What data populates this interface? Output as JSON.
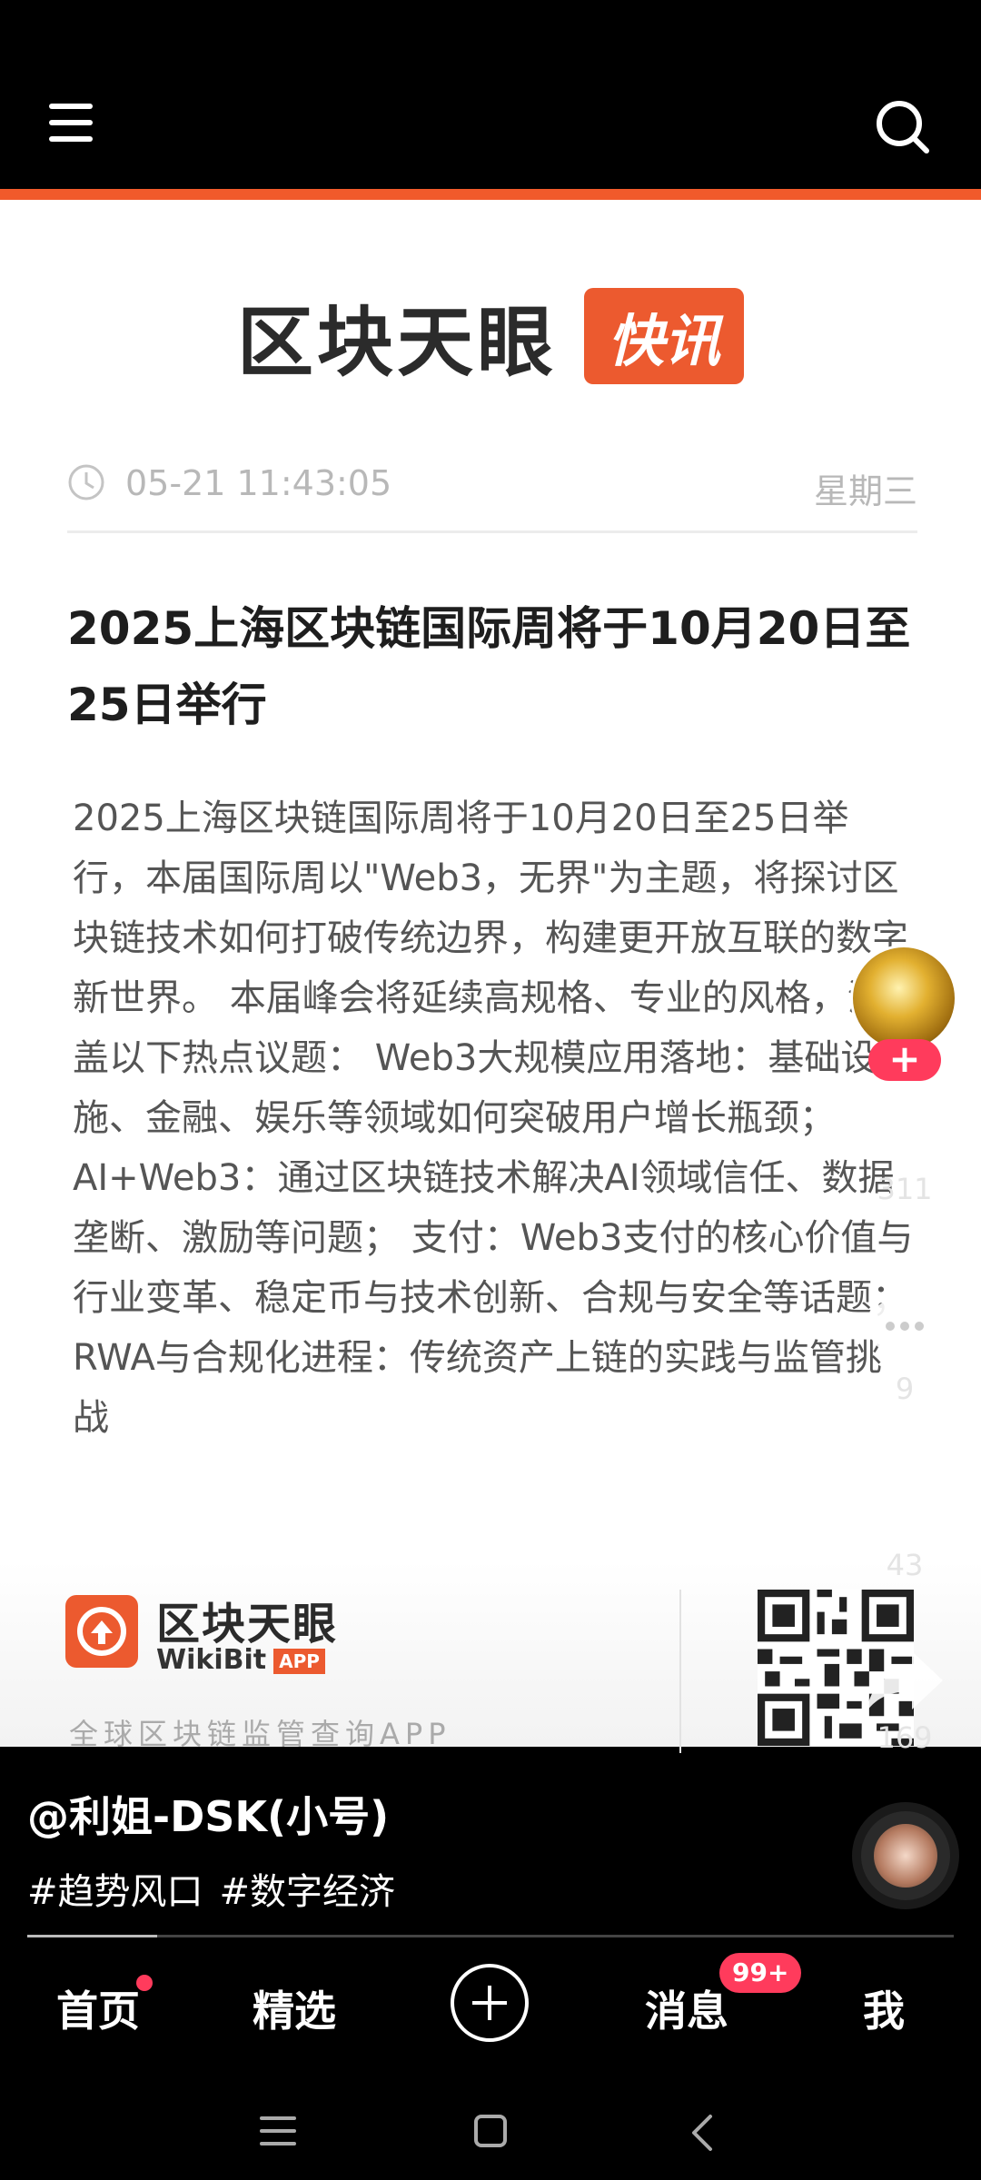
{
  "header": {
    "menu_icon": "menu-icon",
    "search_icon": "search-icon"
  },
  "card": {
    "brand_name": "区块天眼",
    "brand_badge": "快讯",
    "time": "05-21 11:43:05",
    "weekday": "星期三",
    "title": "2025上海区块链国际周将于10月20日至25日举行",
    "body": "2025上海区块链国际周将于10月20日至25日举行，本届国际周以\"Web3，无界\"为主题，将探讨区块链技术如何打破传统边界，构建更开放互联的数字新世界。 本届峰会将延续高规格、专业的风格，涵盖以下热点议题： Web3大规模应用落地：基础设施、金融、娱乐等领域如何突破用户增长瓶颈； AI+Web3：通过区块链技术解决AI领域信任、数据垄断、激励等问题； 支付：Web3支付的核心价值与行业变革、稳定币与技术创新、合规与安全等话题； RWA与合规化进程：传统资产上链的实践与监管挑战",
    "footer_brand": "区块天眼",
    "footer_sub": "WikiBit",
    "footer_app": "APP",
    "footer_slogan": "全球区块链监管查询APP"
  },
  "rail": {
    "follow": "+",
    "likes": "311",
    "comments": "9",
    "favorites": "43",
    "shares": "169"
  },
  "post": {
    "author": "@利姐-DSK(小号)",
    "tags": [
      "#趋势风口",
      "#数字经济"
    ],
    "progress": 0.14
  },
  "nav": {
    "home": "首页",
    "featured": "精选",
    "messages": "消息",
    "messages_badge": "99+",
    "me": "我"
  },
  "colors": {
    "accent": "#f15a2b",
    "badge": "#ff3b5c"
  }
}
